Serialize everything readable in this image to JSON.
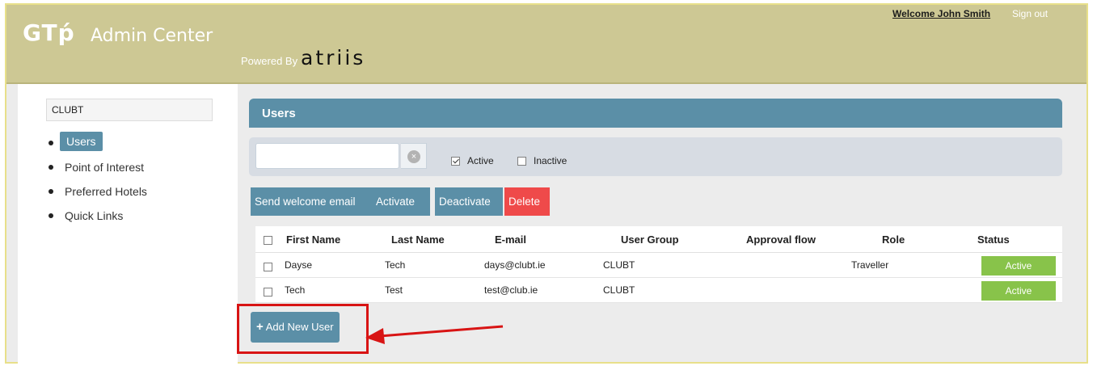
{
  "header": {
    "logo_text": "GTṕ",
    "app_title": "Admin Center",
    "powered_by": "Powered By",
    "brand": "atriis",
    "welcome": "Welcome John Smith",
    "sign_out": "Sign out"
  },
  "sidebar": {
    "client": "CLUBT",
    "items": [
      {
        "label": "Users",
        "active": true
      },
      {
        "label": "Point of Interest",
        "active": false
      },
      {
        "label": "Preferred Hotels",
        "active": false
      },
      {
        "label": "Quick Links",
        "active": false
      }
    ]
  },
  "main": {
    "section_title": "Users",
    "search": {
      "value": "",
      "placeholder": "",
      "clear_icon": "×"
    },
    "filters": {
      "active_label": "Active",
      "active_checked": true,
      "inactive_label": "Inactive",
      "inactive_checked": false
    },
    "actions": {
      "send_welcome": "Send welcome email",
      "activate": "Activate",
      "deactivate": "Deactivate",
      "delete": "Delete"
    },
    "table": {
      "columns": [
        "First Name",
        "Last Name",
        "E-mail",
        "User Group",
        "Approval flow",
        "Role",
        "Status"
      ],
      "rows": [
        {
          "first": "Dayse",
          "last": "Tech",
          "email": "days@clubt.ie",
          "group": "CLUBT",
          "approval": "",
          "role": "Traveller",
          "status": "Active"
        },
        {
          "first": "Tech",
          "last": "Test",
          "email": "test@club.ie",
          "group": "CLUBT",
          "approval": "",
          "role": "",
          "status": "Active"
        }
      ]
    },
    "add_button": "Add New User",
    "add_icon": "+"
  },
  "colors": {
    "header_bg": "#cdc894",
    "accent": "#5b8fa7",
    "delete": "#ef4a4a",
    "status_active": "#88c34a",
    "annotation": "#d81414"
  }
}
